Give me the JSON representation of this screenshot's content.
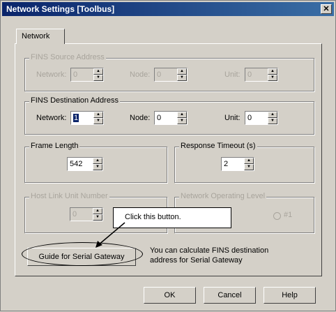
{
  "window": {
    "title": "Network Settings [Toolbus]",
    "close_glyph": "✕"
  },
  "tabs": [
    {
      "label": "Network"
    }
  ],
  "fins_source": {
    "label": "FINS Source Address",
    "network_label": "Network:",
    "network_value": "0",
    "node_label": "Node:",
    "node_value": "0",
    "unit_label": "Unit:",
    "unit_value": "0"
  },
  "fins_destination": {
    "label": "FINS Destination Address",
    "network_label": "Network:",
    "network_value": "1",
    "node_label": "Node:",
    "node_value": "0",
    "unit_label": "Unit:",
    "unit_value": "0"
  },
  "frame_length": {
    "label": "Frame Length",
    "value": "542"
  },
  "response_timeout": {
    "label": "Response Timeout (s)",
    "value": "2"
  },
  "host_link": {
    "label": "Host Link Unit Number",
    "value": "0"
  },
  "network_level": {
    "label": "Network Operating Level",
    "option": "#1"
  },
  "callout": {
    "text": "Click this button."
  },
  "guide_button": {
    "label": "Guide for Serial Gateway"
  },
  "guide_help": {
    "line1": "You can calculate FINS destination",
    "line2": "address for Serial Gateway"
  },
  "footer": {
    "ok": "OK",
    "cancel": "Cancel",
    "help": "Help"
  }
}
